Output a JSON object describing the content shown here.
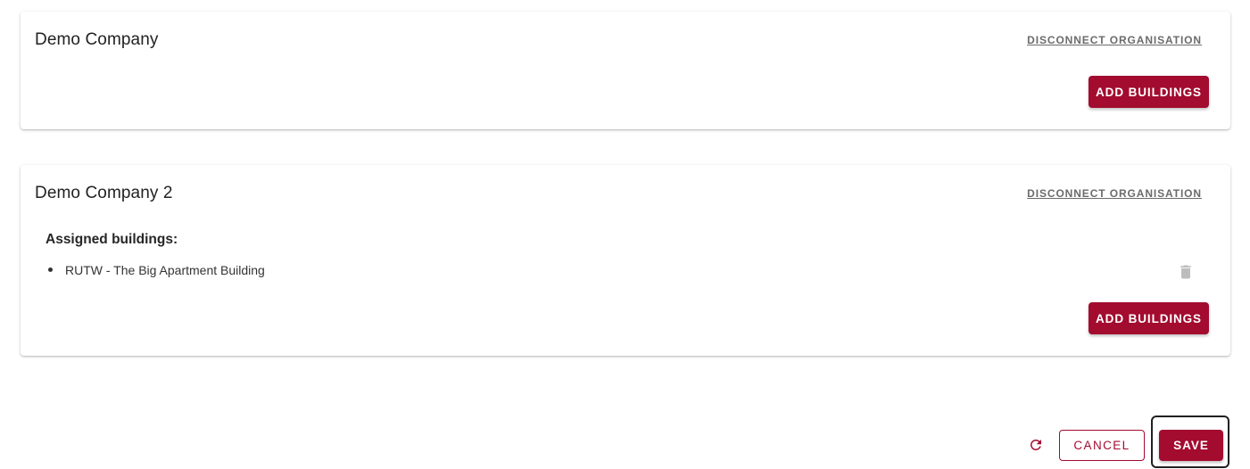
{
  "colors": {
    "primary": "#a30b2f",
    "link": "#6b6b6b",
    "icon_disabled": "#bdbdbd"
  },
  "organisations": [
    {
      "name": "Demo Company",
      "disconnect_label": "DISCONNECT ORGANISATION",
      "add_buildings_label": "ADD BUILDINGS",
      "assigned_label": "",
      "buildings": []
    },
    {
      "name": "Demo Company 2",
      "disconnect_label": "DISCONNECT ORGANISATION",
      "add_buildings_label": "ADD BUILDINGS",
      "assigned_label": "Assigned buildings:",
      "buildings": [
        {
          "name": "RUTW - The Big Apartment Building",
          "delete_icon": "trash-icon"
        }
      ]
    }
  ],
  "footer": {
    "refresh_icon": "refresh-icon",
    "cancel_label": "CANCEL",
    "save_label": "SAVE"
  }
}
